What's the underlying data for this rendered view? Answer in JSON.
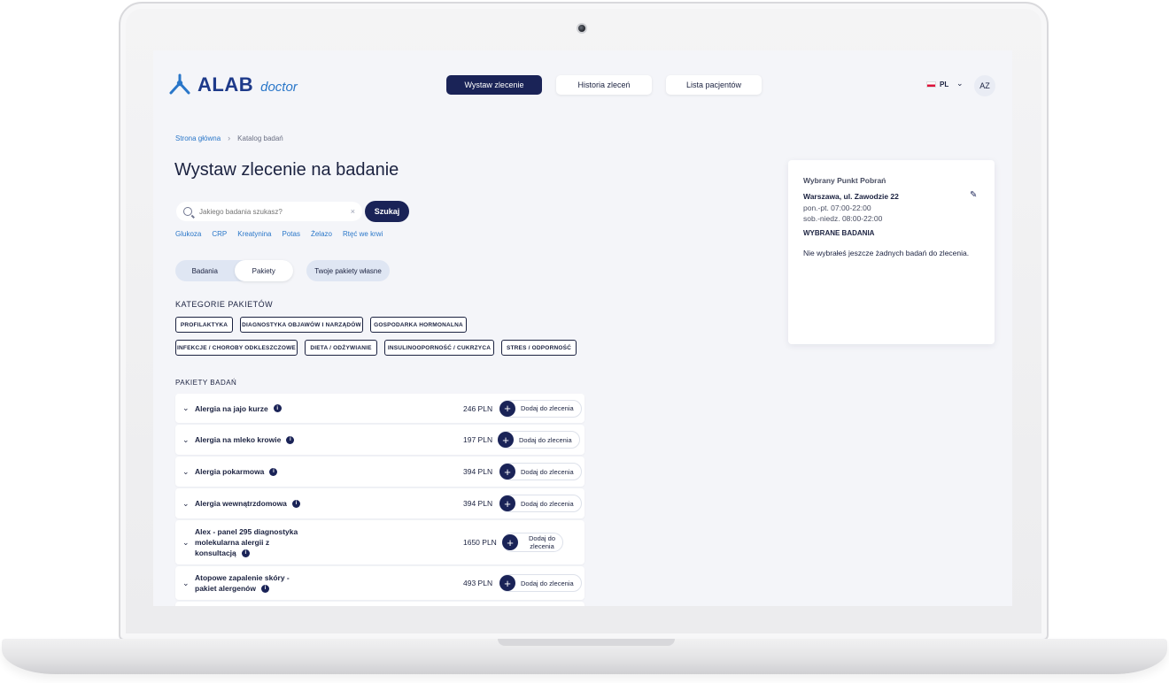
{
  "logo": {
    "brand": "ALAB",
    "sub": "doctor"
  },
  "nav": {
    "issue_order": "Wystaw zlecenie",
    "order_history": "Historia zleceń",
    "patient_list": "Lista pacjentów"
  },
  "language": {
    "code": "PL"
  },
  "user": {
    "initials": "AZ"
  },
  "breadcrumb": {
    "home": "Strona główna",
    "current": "Katalog badań"
  },
  "page_title": "Wystaw zlecenie na badanie",
  "search": {
    "placeholder": "Jakiego badania szukasz?",
    "clear": "×",
    "button": "Szukaj"
  },
  "quick_links": [
    "Glukoza",
    "CRP",
    "Kreatynina",
    "Potas",
    "Żelazo",
    "Rtęć we krwi"
  ],
  "toggle": {
    "tests": "Badania",
    "packages": "Pakiety",
    "own_packages": "Twoje pakiety własne",
    "selected": "Pakiety"
  },
  "categories_title": "KATEGORIE PAKIETÓW",
  "categories": [
    "PROFILAKTYKA",
    "DIAGNOSTYKA OBJAWÓW I NARZĄDÓW",
    "GOSPODARKA HORMONALNA",
    "INFEKCJE / CHOROBY ODKLESZCZOWE",
    "DIETA / ODŻYWIANIE",
    "INSULINOOPORNOŚĆ / CUKRZYCA",
    "STRES / ODPORNOŚĆ"
  ],
  "packages_title": "PAKIETY BADAŃ",
  "packages": [
    {
      "name": "Alergia na jajo kurze",
      "price": "246 PLN",
      "add": "Dodaj do zlecenia"
    },
    {
      "name": "Alergia na mleko krowie",
      "price": "197 PLN",
      "add": "Dodaj do zlecenia"
    },
    {
      "name": "Alergia pokarmowa",
      "price": "394 PLN",
      "add": "Dodaj do zlecenia"
    },
    {
      "name": "Alergia wewnątrzdomowa",
      "price": "394 PLN",
      "add": "Dodaj do zlecenia"
    },
    {
      "name_lines": [
        "Alex - panel 295 diagnostyka",
        "molekularna alergii z",
        "konsultacją"
      ],
      "price": "1650 PLN",
      "add_lines": [
        "Dodaj do",
        "zlecenia"
      ]
    },
    {
      "name_lines": [
        "Atopowe zapalenie skóry -",
        "pakiet alergenów"
      ],
      "price": "493 PLN",
      "add": "Dodaj do zlecenia"
    }
  ],
  "card": {
    "title": "Wybrany Punkt Pobrań",
    "address": "Warszawa, ul. Zawodzie 22",
    "hours_weekdays": "pon.-pt. 07:00-22:00",
    "hours_weekend": "sob.-niedz. 08:00-22:00",
    "selected_title": "WYBRANE BADANIA",
    "empty_message": "Nie wybrałeś jeszcze żadnych badań do zlecenia."
  },
  "icons": [
    "logo-icon",
    "flag-icon",
    "chevron-down-icon",
    "search-icon",
    "close-icon",
    "info-icon",
    "plus-icon",
    "pencil-icon",
    "camera-icon"
  ],
  "colors": {
    "primary": "#1a2357",
    "link": "#2a77c9",
    "background": "#f4f5f9"
  }
}
